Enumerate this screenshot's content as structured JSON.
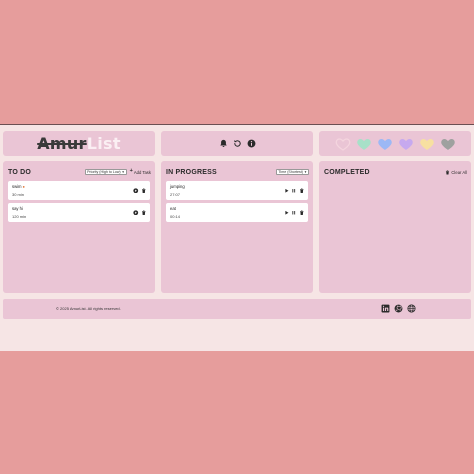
{
  "header": {
    "logo_part1": "Amur",
    "logo_part2": "List",
    "icons": [
      "bell-icon",
      "restart-icon",
      "info-icon"
    ],
    "themes": [
      {
        "name": "pink-heart-outline",
        "color": "#f4d5de"
      },
      {
        "name": "mint-heart",
        "color": "#a7e0c8"
      },
      {
        "name": "blue-heart",
        "color": "#9cb8f5"
      },
      {
        "name": "lavender-heart",
        "color": "#c6a9ef"
      },
      {
        "name": "yellow-heart",
        "color": "#f7e0a1"
      },
      {
        "name": "gray-heart",
        "color": "#9ea19f"
      }
    ]
  },
  "todo": {
    "title": "TO DO",
    "sort_value": "Priority (High to Low)",
    "add_label": "Add Task",
    "tasks": [
      {
        "name": "swim",
        "flag": "fire",
        "time": "30 min"
      },
      {
        "name": "say hi",
        "time": "120 min"
      }
    ]
  },
  "in_progress": {
    "title": "IN PROGRESS",
    "sort_value": "Time (Shortest)",
    "tasks": [
      {
        "name": "jumping",
        "time": "27:07"
      },
      {
        "name": "eat",
        "time": "00:14"
      }
    ]
  },
  "completed": {
    "title": "COMPLETED",
    "clear_label": "Clear All"
  },
  "footer": {
    "copyright": "© 2025 AmurList. All rights reserved.",
    "icons": [
      "linkedin-icon",
      "github-icon",
      "globe-icon"
    ]
  },
  "colors": {
    "page_bg": "#e69d9c",
    "app_bg": "#f6e5e5",
    "card_bg": "#eac5d5",
    "task_bg": "#ffffff",
    "accent_text": "#2b2b2b"
  }
}
